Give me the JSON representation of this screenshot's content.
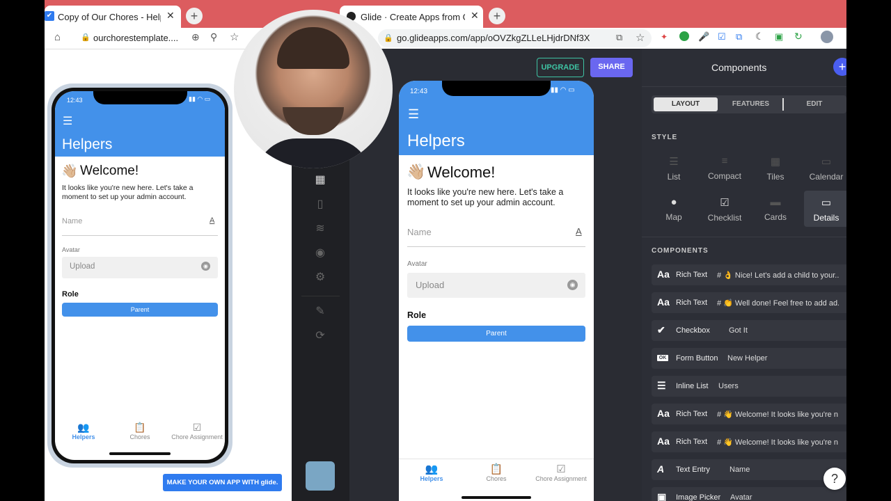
{
  "left_browser": {
    "tab_title": "Copy of Our Chores - Helpers",
    "url": "ourchorestemplate....",
    "phone": {
      "time": "12:43",
      "header_title": "Helpers",
      "welcome_emoji": "👋🏼",
      "welcome_text": "Welcome!",
      "intro_text": "It looks like you're new here. Let's take a moment to set up your admin account.",
      "name_placeholder": "Name",
      "avatar_label": "Avatar",
      "upload_label": "Upload",
      "role_label": "Role",
      "role_button": "Parent",
      "nav": [
        "Helpers",
        "Chores",
        "Chore Assignment"
      ]
    },
    "promo_button": "MAKE YOUR OWN APP WITH glide."
  },
  "right_browser": {
    "tab_title": "Glide · Create Apps from Goog",
    "url": "go.glideapps.com/app/oOVZkgZLLeLHjdrDNf3X",
    "upgrade_label": "UPGRADE",
    "share_label": "SHARE",
    "phone": {
      "time": "12:43",
      "header_title": "Helpers",
      "welcome_emoji": "👋🏼",
      "welcome_text": "Welcome!",
      "intro_text": "It looks like you're new here. Let's take a moment to set up your admin account.",
      "name_placeholder": "Name",
      "avatar_label": "Avatar",
      "upload_label": "Upload",
      "role_label": "Role",
      "role_button": "Parent",
      "nav": [
        "Helpers",
        "Chores",
        "Chore Assignment"
      ]
    },
    "panel": {
      "title": "Components",
      "tabs": [
        "LAYOUT",
        "FEATURES",
        "EDIT"
      ],
      "style_heading": "STYLE",
      "styles": [
        "List",
        "Compact",
        "Tiles",
        "Calendar",
        "Map",
        "Checklist",
        "Cards",
        "Details"
      ],
      "components_heading": "COMPONENTS",
      "components": [
        {
          "icon": "Aa",
          "type": "Rich Text",
          "value": "# 👌 Nice! Let's add a child to your..."
        },
        {
          "icon": "Aa",
          "type": "Rich Text",
          "value": "# 👏 Well done! Feel free to add ad..."
        },
        {
          "icon": "✔",
          "type": "Checkbox",
          "value": "Got It"
        },
        {
          "icon": "OK",
          "type": "Form Button",
          "value": "New Helper"
        },
        {
          "icon": "☰",
          "type": "Inline List",
          "value": "Users"
        },
        {
          "icon": "Aa",
          "type": "Rich Text",
          "value": "# 👋 Welcome! It looks like you're n..."
        },
        {
          "icon": "Aa",
          "type": "Rich Text",
          "value": "# 👋 Welcome! It looks like you're n..."
        },
        {
          "icon": "A",
          "type": "Text Entry",
          "value": "Name"
        },
        {
          "icon": "▣",
          "type": "Image Picker",
          "value": "Avatar"
        }
      ],
      "help_label": "?"
    }
  },
  "colors": {
    "brand_blue": "#4391ea",
    "tab_red": "#dc5c5f",
    "panel_dark": "#2c2e36",
    "accent_purple": "#6a67f0"
  }
}
